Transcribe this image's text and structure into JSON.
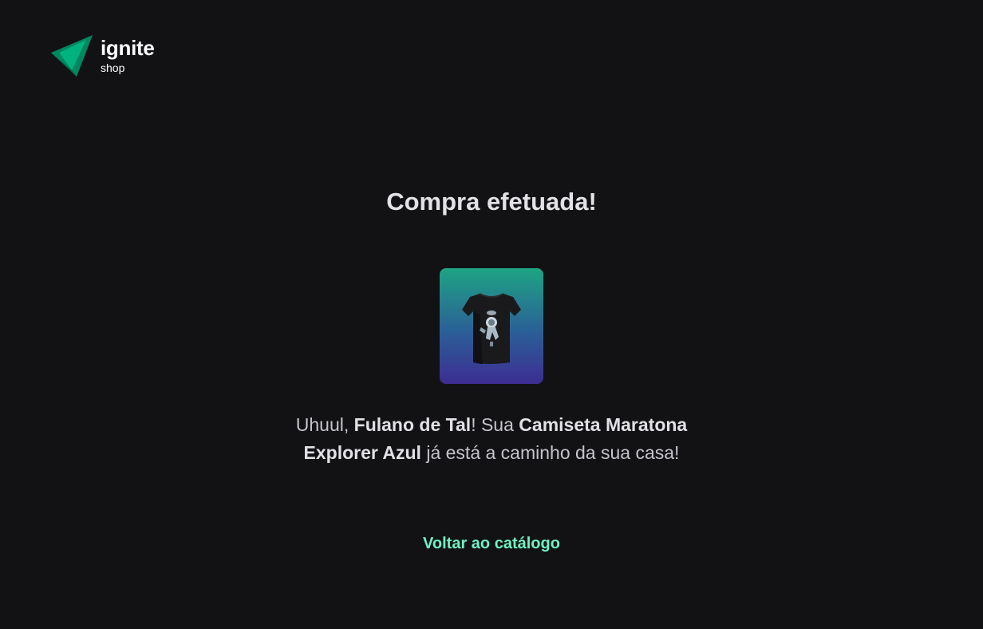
{
  "brand": {
    "name": "ignite",
    "tagline": "shop",
    "icon": "ignite-logo-icon",
    "colors": {
      "dark": "#00875f",
      "light": "#00b37e"
    }
  },
  "success": {
    "title": "Compra efetuada!",
    "message": {
      "part1": "Uhuul, ",
      "customer_name": "Fulano de Tal",
      "part2": "! Sua ",
      "product_name": "Camiseta Maratona Explorer Azul",
      "part3": " já está a caminho da sua casa!"
    },
    "product_image_icon": "tshirt-icon",
    "back_link_label": "Voltar ao catálogo",
    "accent_color": "#6ef2c3"
  }
}
